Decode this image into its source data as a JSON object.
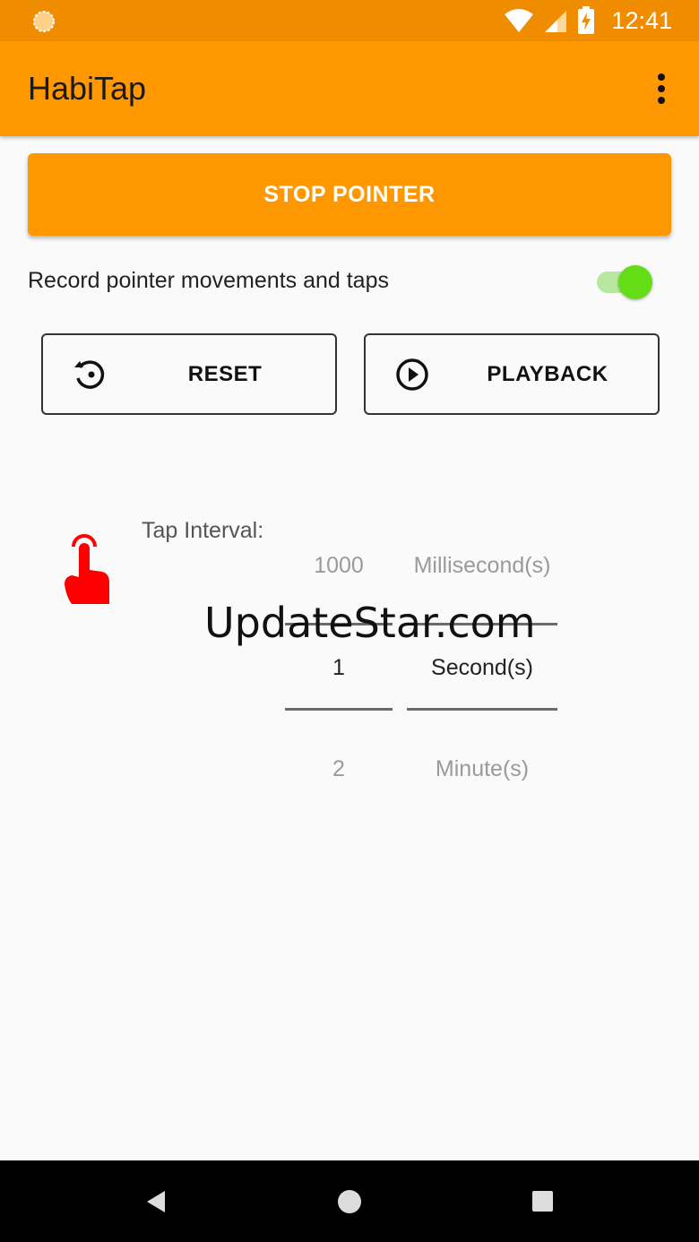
{
  "status_bar": {
    "time": "12:41",
    "left_icon": "notification-sun-icon",
    "icons": [
      "wifi-icon",
      "signal-icon",
      "battery-charging-icon"
    ]
  },
  "app_bar": {
    "title": "HabiTap",
    "overflow_icon": "more-vert-icon"
  },
  "stop_button": {
    "label": "STOP POINTER"
  },
  "record_toggle": {
    "label": "Record pointer movements and taps",
    "checked": true
  },
  "reset_button": {
    "label": "RESET",
    "icon": "history-icon"
  },
  "playback_button": {
    "label": "PLAYBACK",
    "icon": "play-circle-icon"
  },
  "tap_interval": {
    "icon": "hand-pointer-icon",
    "label": "Tap Interval:",
    "value_picker": {
      "prev": "1000",
      "selected": "1",
      "next": "2"
    },
    "unit_picker": {
      "prev": "Millisecond(s)",
      "selected": "Second(s)",
      "next": "Minute(s)"
    }
  },
  "watermark": "UpdateStar.com",
  "nav_bar": {
    "icons": [
      "back-icon",
      "home-icon",
      "recents-icon"
    ]
  },
  "colors": {
    "status_bar": "#f08c00",
    "app_bar": "#ff9800",
    "switch_on": "#64dd17",
    "hand_icon": "#ff0000"
  }
}
